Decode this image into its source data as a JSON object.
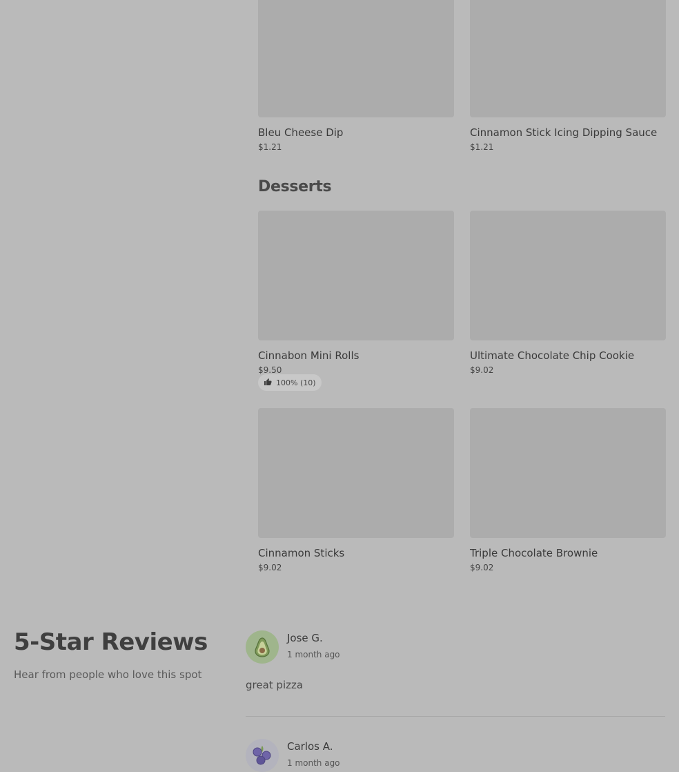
{
  "menu": {
    "top_items": [
      {
        "name": "Bleu Cheese Dip",
        "price": "$1.21"
      },
      {
        "name": "Cinnamon Stick Icing Dipping Sauce",
        "price": "$1.21"
      }
    ],
    "desserts_section": {
      "title": "Desserts",
      "items": [
        {
          "name": "Cinnabon Mini Rolls",
          "price": "$9.50",
          "rating": "100% (10)"
        },
        {
          "name": "Ultimate Chocolate Chip Cookie",
          "price": "$9.02"
        },
        {
          "name": "Cinnamon Sticks",
          "price": "$9.02"
        },
        {
          "name": "Triple Chocolate Brownie",
          "price": "$9.02"
        }
      ]
    }
  },
  "reviews": {
    "title": "5-Star Reviews",
    "subtitle": "Hear from people who love this spot",
    "items": [
      {
        "author": "Jose G.",
        "time": "1 month ago",
        "text": "great pizza",
        "avatar_icon": "avocado-icon"
      },
      {
        "author": "Carlos A.",
        "time": "1 month ago",
        "avatar_icon": "blueberry-icon"
      }
    ]
  },
  "colors": {
    "overlay_background": "#bababa",
    "image_placeholder": "#acacac",
    "avocado_avatar_bg": "#9fb58c",
    "blueberry_avatar_bg": "#b3b3bd"
  }
}
